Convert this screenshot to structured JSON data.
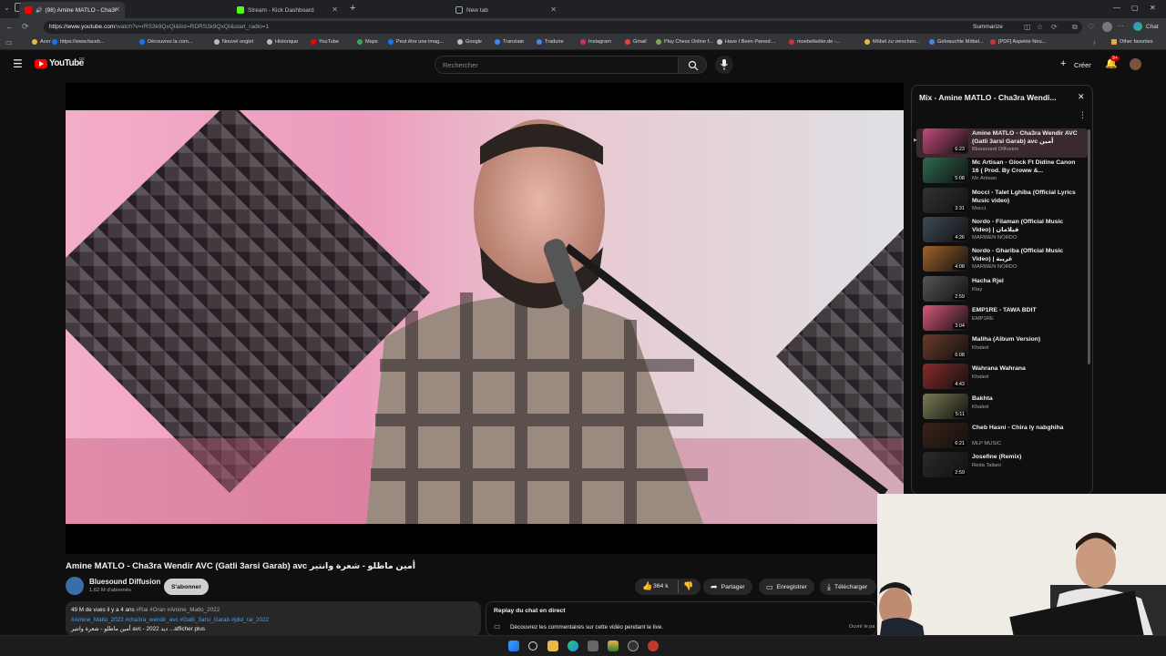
{
  "browser": {
    "tabs": [
      {
        "title": "(98) Amine MATLO - Cha3r",
        "active": true,
        "color": "#ff0000"
      },
      {
        "title": "Stream - Kick Dashboard",
        "active": false,
        "color": "#53fc18"
      },
      {
        "title": "New tab",
        "active": false,
        "color": "#9aa0a6"
      }
    ],
    "url_domain": "https://www.youtube.com",
    "url_path": "/watch?v=rRS3k9QxQI&list=RDRS3k9QxQI&start_radio=1",
    "summarize": "Summarize",
    "chat": "Chat",
    "bookmarks": [
      "Acer",
      "https://www.faceb...",
      "Découvrez la com...",
      "Nouvel onglet",
      "Historique",
      "YouTube",
      "Maps",
      "Peut être une imag...",
      "Google",
      "Translate",
      "Traduire",
      "Instagram",
      "Gmail",
      "Play Chess Online f...",
      "Have I Been Pwned:...",
      "moebelkeller.de -...",
      "Möbel zu verschen...",
      "Gebrauchte Möbel...",
      "[PDF] Aspekte Neu..."
    ],
    "other_favorites": "Other favorites"
  },
  "youtube": {
    "logo": "YouTube",
    "country": "DE",
    "search_placeholder": "Rechercher",
    "create_label": "Créer",
    "notif_count": "9+"
  },
  "video": {
    "title": "Amine MATLO - Cha3ra Wendir AVC (Gatli 3arsi Garab) avc أمين ماطلو - شعرة وانتير",
    "channel": "Bluesound Diffusion",
    "subscribers": "1,62 M d'abonnés",
    "subscribe": "S'abonner",
    "likes": "364 k",
    "share": "Partager",
    "save": "Enregistrer",
    "download": "Télécharger",
    "desc_line1_views": "49 M de vues  il y a 4 ans",
    "desc_line1_tags": "#Rai #Oran #Amine_Matlo_2022",
    "desc_line2": "#Amine_Matlo_2022 #cha3ra_wendir_avc #Gatli_3arsi_Garab #jdid_rai_2022",
    "desc_line3": "أمين ماطلو - شعرة وانتير avc - 2022  ديد  ...afficher plus",
    "chat_title": "Replay du chat en direct",
    "chat_text": "Découvrez les commentaires sur cette vidéo pendant le live.",
    "chat_open": "Ouvrir le pa"
  },
  "playlist": {
    "title": "Mix - Amine MATLO - Cha3ra Wendi...",
    "items": [
      {
        "title": "Amine MATLO - Cha3ra Wendir AVC (Gatli 3arsi Garab) avc أمين",
        "channel": "Bluesound Diffusion",
        "duration": "6:23",
        "thumb": "#c34a7b"
      },
      {
        "title": "Mc Artisan - Glock Ft Didine Canon 16 ( Prod. By Croww &...",
        "channel": "Mc Artisan",
        "duration": "5:08",
        "thumb": "#2e6a4f"
      },
      {
        "title": "Mocci - Talet Lghiba (Official Lyrics Music video)",
        "channel": "Mocci",
        "duration": "3:31",
        "thumb": "#333"
      },
      {
        "title": "Nordo - Filaman (Official Music Video) | فيلامان",
        "channel": "MARWEN NORDO",
        "duration": "4:26",
        "thumb": "#3d4a55"
      },
      {
        "title": "Nordo - Ghariba (Official Music Video) | غريبة",
        "channel": "MARWEN NORDO",
        "duration": "4:08",
        "thumb": "#a0622a"
      },
      {
        "title": "Hacha Rjel",
        "channel": "Klay",
        "duration": "2:59",
        "thumb": "#555"
      },
      {
        "title": "EMP1RE - TAWA BDIT",
        "channel": "EMP1RE",
        "duration": "3:04",
        "thumb": "#d8587a"
      },
      {
        "title": "Maliha (Album Version)",
        "channel": "Khaled",
        "duration": "6:08",
        "thumb": "#6b3a2a"
      },
      {
        "title": "Wahrana Wahrana",
        "channel": "Khaled",
        "duration": "4:43",
        "thumb": "#8a2a2a"
      },
      {
        "title": "Bakhta",
        "channel": "Khaled",
        "duration": "5:11",
        "thumb": "#7a7a55"
      },
      {
        "title": "Cheb Hasni - Chira ly nabghiha",
        "channel": "MLP MUSIC",
        "duration": "6:21",
        "thumb": "#3a2218"
      },
      {
        "title": "Josefine (Remix)",
        "channel": "Reda Taliani",
        "duration": "2:59",
        "thumb": "#2a2a2a"
      }
    ]
  },
  "colors": {
    "accent": "#ff0000",
    "bg": "#0f0f0f",
    "pill": "#272727"
  }
}
